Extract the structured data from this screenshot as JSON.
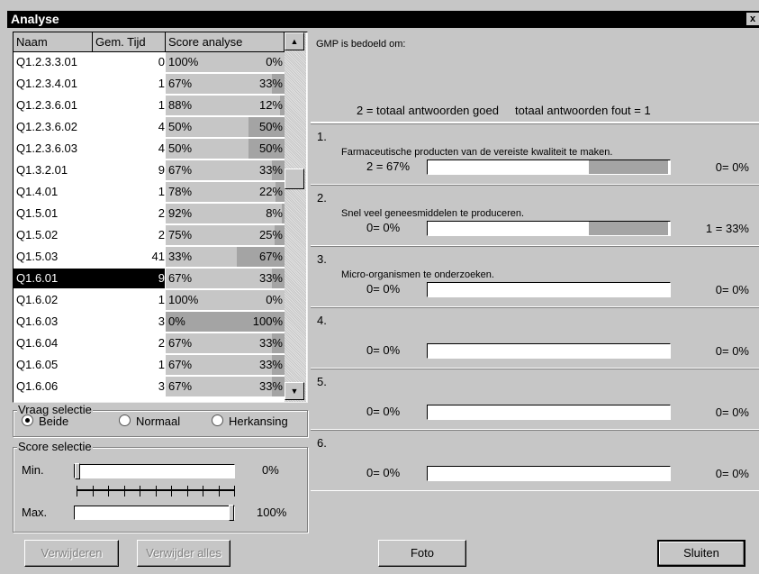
{
  "window": {
    "title": "Analyse",
    "close_glyph": "x"
  },
  "table": {
    "headers": [
      "Naam",
      "Gem. Tijd",
      "Score analyse"
    ],
    "rows": [
      {
        "name": "Q1.2.3.3.01",
        "time": "0",
        "score": "100%",
        "wrong": "0%",
        "wrong_frac": 0.0
      },
      {
        "name": "Q1.2.3.4.01",
        "time": "1",
        "score": "67%",
        "wrong": "33%",
        "wrong_frac": 0.33
      },
      {
        "name": "Q1.2.3.6.01",
        "time": "1",
        "score": "88%",
        "wrong": "12%",
        "wrong_frac": 0.12
      },
      {
        "name": "Q1.2.3.6.02",
        "time": "4",
        "score": "50%",
        "wrong": "50%",
        "wrong_frac": 0.5
      },
      {
        "name": "Q1.2.3.6.03",
        "time": "4",
        "score": "50%",
        "wrong": "50%",
        "wrong_frac": 0.5
      },
      {
        "name": "Q1.3.2.01",
        "time": "9",
        "score": "67%",
        "wrong": "33%",
        "wrong_frac": 0.33
      },
      {
        "name": "Q1.4.01",
        "time": "1",
        "score": "78%",
        "wrong": "22%",
        "wrong_frac": 0.22
      },
      {
        "name": "Q1.5.01",
        "time": "2",
        "score": "92%",
        "wrong": "8%",
        "wrong_frac": 0.08
      },
      {
        "name": "Q1.5.02",
        "time": "2",
        "score": "75%",
        "wrong": "25%",
        "wrong_frac": 0.25
      },
      {
        "name": "Q1.5.03",
        "time": "41",
        "score": "33%",
        "wrong": "67%",
        "wrong_frac": 0.67
      },
      {
        "name": "Q1.6.01",
        "time": "9",
        "score": "67%",
        "wrong": "33%",
        "wrong_frac": 0.33,
        "selected": true
      },
      {
        "name": "Q1.6.02",
        "time": "1",
        "score": "100%",
        "wrong": "0%",
        "wrong_frac": 0.0
      },
      {
        "name": "Q1.6.03",
        "time": "3",
        "score": "0%",
        "wrong": "100%",
        "wrong_frac": 1.0
      },
      {
        "name": "Q1.6.04",
        "time": "2",
        "score": "67%",
        "wrong": "33%",
        "wrong_frac": 0.33
      },
      {
        "name": "Q1.6.05",
        "time": "1",
        "score": "67%",
        "wrong": "33%",
        "wrong_frac": 0.33
      },
      {
        "name": "Q1.6.06",
        "time": "3",
        "score": "67%",
        "wrong": "33%",
        "wrong_frac": 0.33
      }
    ]
  },
  "vraag_selectie": {
    "label": "Vraag selectie",
    "options": [
      "Beide",
      "Normaal",
      "Herkansing"
    ],
    "selected": "Beide"
  },
  "score_selectie": {
    "label": "Score selectie",
    "min_label": "Min.",
    "min_value": "0%",
    "min_frac": 0.0,
    "max_label": "Max.",
    "max_value": "100%",
    "max_frac": 1.0
  },
  "question": {
    "text": "GMP is bedoeld om:",
    "summary": "2 = totaal antwoorden goed     totaal antwoorden fout = 1"
  },
  "answers": [
    {
      "num": "1.",
      "text": "Farmaceutische producten van de vereiste kwaliteit te maken.",
      "correct": "2 = 67%",
      "correct_frac": 0.67,
      "wrong": "0= 0%",
      "wrong_frac": 0.0
    },
    {
      "num": "2.",
      "text": "Snel veel geneesmiddelen te produceren.",
      "correct": "0= 0%",
      "correct_frac": 0.0,
      "wrong": "1 = 33%",
      "wrong_frac": 0.33
    },
    {
      "num": "3.",
      "text": "Micro-organismen te onderzoeken.",
      "correct": "0= 0%",
      "correct_frac": 0.0,
      "wrong": "0= 0%",
      "wrong_frac": 0.0
    },
    {
      "num": "4.",
      "text": "",
      "correct": "0= 0%",
      "correct_frac": 0.0,
      "wrong": "0= 0%",
      "wrong_frac": 0.0
    },
    {
      "num": "5.",
      "text": "",
      "correct": "0= 0%",
      "correct_frac": 0.0,
      "wrong": "0= 0%",
      "wrong_frac": 0.0
    },
    {
      "num": "6.",
      "text": "",
      "correct": "0= 0%",
      "correct_frac": 0.0,
      "wrong": "0= 0%",
      "wrong_frac": 0.0
    }
  ],
  "buttons": {
    "verwijderen": "Verwijderen",
    "verwijder_alles": "Verwijder alles",
    "foto": "Foto",
    "sluiten": "Sluiten"
  },
  "colors": {
    "bar_fill": "#a4a4a4",
    "face": "#c6c6c6",
    "title_bg": "#000000"
  }
}
